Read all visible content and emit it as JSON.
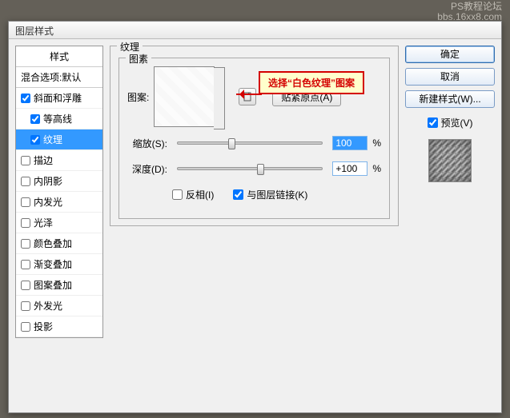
{
  "watermark": {
    "line1": "PS教程论坛",
    "line2": "bbs.16xx8.com"
  },
  "dialog": {
    "title": "图层样式"
  },
  "styles": {
    "header": "样式",
    "blending": "混合选项:默认",
    "items": [
      {
        "label": "斜面和浮雕",
        "checked": true,
        "indent": false,
        "selected": false
      },
      {
        "label": "等高线",
        "checked": true,
        "indent": true,
        "selected": false
      },
      {
        "label": "纹理",
        "checked": true,
        "indent": true,
        "selected": true
      },
      {
        "label": "描边",
        "checked": false,
        "indent": false,
        "selected": false
      },
      {
        "label": "内阴影",
        "checked": false,
        "indent": false,
        "selected": false
      },
      {
        "label": "内发光",
        "checked": false,
        "indent": false,
        "selected": false
      },
      {
        "label": "光泽",
        "checked": false,
        "indent": false,
        "selected": false
      },
      {
        "label": "颜色叠加",
        "checked": false,
        "indent": false,
        "selected": false
      },
      {
        "label": "渐变叠加",
        "checked": false,
        "indent": false,
        "selected": false
      },
      {
        "label": "图案叠加",
        "checked": false,
        "indent": false,
        "selected": false
      },
      {
        "label": "外发光",
        "checked": false,
        "indent": false,
        "selected": false
      },
      {
        "label": "投影",
        "checked": false,
        "indent": false,
        "selected": false
      }
    ]
  },
  "main": {
    "section_label": "纹理",
    "element_group": "图素",
    "pattern_label": "图案:",
    "snap_button": "贴紧原点(A)",
    "scale_label": "缩放(S):",
    "scale_value": "100",
    "depth_label": "深度(D):",
    "depth_value": "+100",
    "percent": "%",
    "invert_label": "反相(I)",
    "invert_checked": false,
    "link_label": "与图层链接(K)",
    "link_checked": true
  },
  "callout": {
    "text": "选择“白色纹理”图案"
  },
  "buttons": {
    "ok": "确定",
    "cancel": "取消",
    "new_style": "新建样式(W)...",
    "preview": "预览(V)",
    "preview_checked": true
  }
}
